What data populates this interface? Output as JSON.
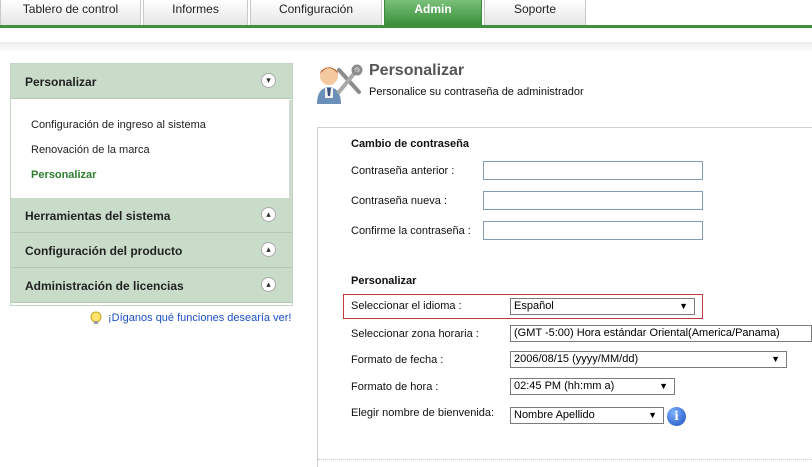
{
  "tabs": [
    {
      "label": "Tablero de control"
    },
    {
      "label": "Informes"
    },
    {
      "label": "Configuración"
    },
    {
      "label": "Admin"
    },
    {
      "label": "Soporte"
    }
  ],
  "sidebar": {
    "sections": [
      {
        "label": "Personalizar",
        "toggle": "»"
      },
      {
        "label": "Herramientas del sistema",
        "toggle": "«"
      },
      {
        "label": "Configuración del producto",
        "toggle": "«"
      },
      {
        "label": "Administración de licencias",
        "toggle": "«"
      }
    ],
    "items": [
      {
        "label": "Configuración de ingreso al sistema"
      },
      {
        "label": "Renovación de la marca"
      },
      {
        "label": "Personalizar"
      }
    ],
    "feedback": "¡Díganos qué funciones desearía ver!"
  },
  "header": {
    "title": "Personalizar",
    "subtitle": "Personalice su contraseña de administrador"
  },
  "password": {
    "title": "Cambio de contraseña",
    "old_label": "Contraseña anterior :",
    "new_label": "Contraseña nueva :",
    "confirm_label": "Confirme la contraseña :"
  },
  "customize": {
    "title": "Personalizar",
    "language_label": "Seleccionar el idioma :",
    "language_value": "Español",
    "timezone_label": "Seleccionar zona horaria :",
    "timezone_value": "(GMT -5:00) Hora estándar Oriental(America/Panama)",
    "date_label": "Formato de fecha :",
    "date_value": "2006/08/15 (yyyy/MM/dd)",
    "time_label": "Formato de hora :",
    "time_value": "02:45 PM (hh:mm a)",
    "welcome_label": "Elegir nombre de bienvenida:",
    "welcome_value": "Nombre Apellido"
  },
  "colors": {
    "accent": "#3f8f3f",
    "sidebar_header": "#c9dcc9",
    "link": "#1a4fc4",
    "highlight": "#c03a3a"
  }
}
